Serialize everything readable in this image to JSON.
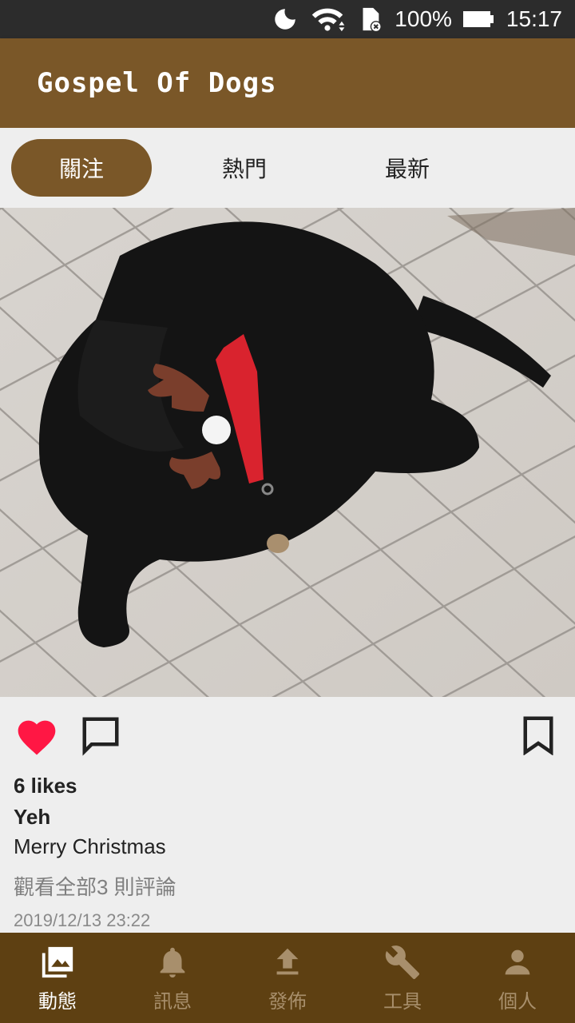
{
  "status_bar": {
    "battery_percent": "100%",
    "time": "15:17",
    "icons": [
      "moon-icon",
      "wifi-icon",
      "sd-card-error-icon",
      "battery-icon"
    ]
  },
  "app": {
    "title": "Gospel Of Dogs",
    "accent_color": "#7a5728",
    "nav_color": "#5e4012"
  },
  "tabs": [
    {
      "label": "關注",
      "active": true
    },
    {
      "label": "熱門",
      "active": false
    },
    {
      "label": "最新",
      "active": false
    }
  ],
  "post": {
    "image_icon": "dog-photo",
    "liked": true,
    "like_color": "#ff1744",
    "likes": "6 likes",
    "author": "Yeh",
    "caption": "Merry Christmas",
    "view_comments": "觀看全部3 則評論",
    "timestamp": "2019/12/13 23:22"
  },
  "bottom_nav": [
    {
      "label": "動態",
      "icon": "photo-library-icon",
      "active": true
    },
    {
      "label": "訊息",
      "icon": "bell-icon",
      "active": false
    },
    {
      "label": "發佈",
      "icon": "upload-icon",
      "active": false
    },
    {
      "label": "工具",
      "icon": "wrench-icon",
      "active": false
    },
    {
      "label": "個人",
      "icon": "person-icon",
      "active": false
    }
  ]
}
